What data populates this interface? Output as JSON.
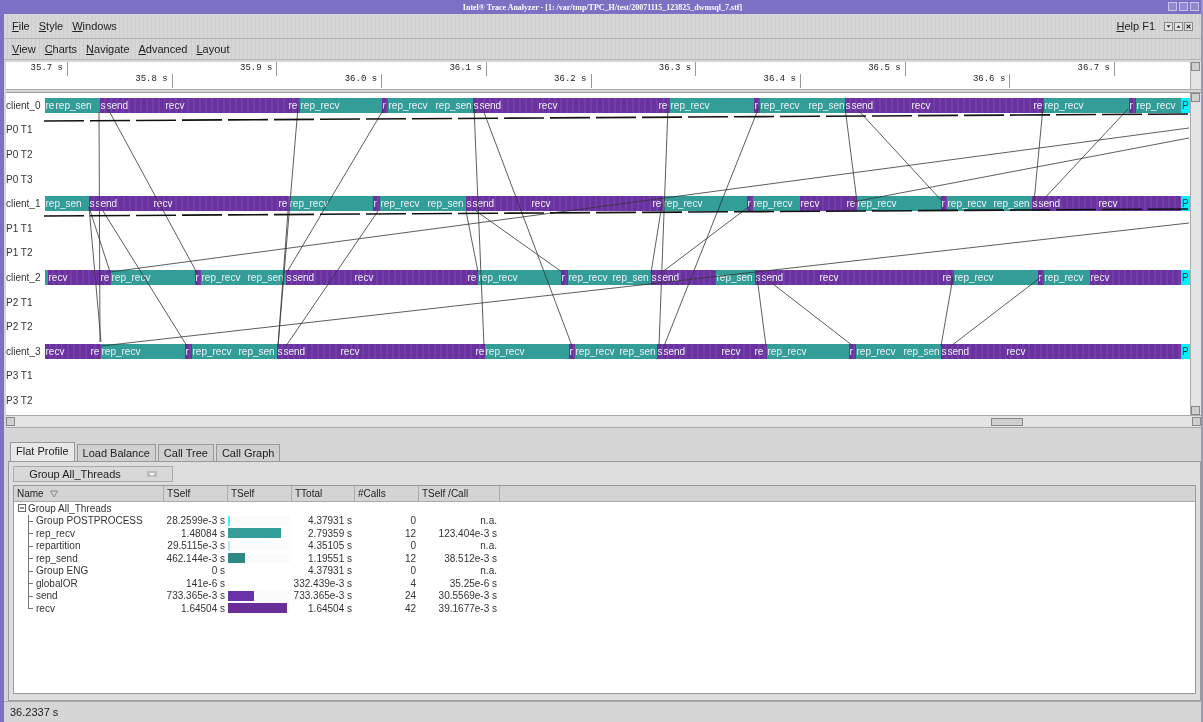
{
  "window": {
    "title": "Intel® Trace Analyzer - [1: /var/tmp/TPC_H/test/20071115_123825_dwmsql_7.stf]"
  },
  "menu": [
    "File",
    "Style",
    "Windows"
  ],
  "help": "Help F1",
  "chart_menu": [
    "View",
    "Charts",
    "Navigate",
    "Advanced",
    "Layout"
  ],
  "ruler": [
    "35.7 s",
    "35.8 s",
    "35.9 s",
    "36.0 s",
    "36.1 s",
    "36.2 s",
    "36.3 s",
    "36.4 s",
    "36.5 s",
    "36.6 s",
    "36.7 s"
  ],
  "lanes": [
    {
      "label": "client_0",
      "segments": [
        {
          "kind": "rep",
          "label": "re"
        },
        {
          "kind": "rep",
          "label": "rep_sen"
        },
        {
          "kind": "mpi",
          "label": "s"
        },
        {
          "kind": "mpi",
          "label": "send"
        },
        {
          "kind": "mpi",
          "label": "recv"
        },
        {
          "kind": "mpi",
          "label": "re"
        },
        {
          "kind": "rep",
          "label": "rep_recv"
        },
        {
          "kind": "mpi",
          "label": "r"
        },
        {
          "kind": "rep",
          "label": "rep_recv"
        },
        {
          "kind": "rep",
          "label": "rep_sen"
        },
        {
          "kind": "mpi",
          "label": "s"
        },
        {
          "kind": "mpi",
          "label": "send"
        },
        {
          "kind": "mpi",
          "label": "recv"
        },
        {
          "kind": "mpi",
          "label": "re"
        },
        {
          "kind": "rep",
          "label": "rep_recv"
        },
        {
          "kind": "mpi",
          "label": "r"
        },
        {
          "kind": "rep",
          "label": "rep_recv"
        },
        {
          "kind": "rep",
          "label": "rep_sen"
        },
        {
          "kind": "mpi",
          "label": "s"
        },
        {
          "kind": "mpi",
          "label": "send"
        },
        {
          "kind": "mpi",
          "label": "recv"
        },
        {
          "kind": "mpi",
          "label": "re"
        },
        {
          "kind": "rep",
          "label": "rep_recv"
        },
        {
          "kind": "mpi",
          "label": "r"
        },
        {
          "kind": "rep",
          "label": "rep_recv"
        },
        {
          "kind": "post",
          "label": "P"
        }
      ]
    },
    {
      "label": "P0 T1"
    },
    {
      "label": "P0 T2"
    },
    {
      "label": "P0 T3"
    },
    {
      "label": "client_1",
      "segments": [
        {
          "kind": "rep",
          "label": "rep_sen"
        },
        {
          "kind": "mpi",
          "label": "s"
        },
        {
          "kind": "mpi",
          "label": "send"
        },
        {
          "kind": "mpi",
          "label": "recv"
        },
        {
          "kind": "mpi",
          "label": "re"
        },
        {
          "kind": "rep",
          "label": "rep_recv"
        },
        {
          "kind": "mpi",
          "label": "r"
        },
        {
          "kind": "rep",
          "label": "rep_recv"
        },
        {
          "kind": "rep",
          "label": "rep_sen"
        },
        {
          "kind": "mpi",
          "label": "s"
        },
        {
          "kind": "mpi",
          "label": "send"
        },
        {
          "kind": "mpi",
          "label": "recv"
        },
        {
          "kind": "mpi",
          "label": "re"
        },
        {
          "kind": "rep",
          "label": "rep_recv"
        },
        {
          "kind": "mpi",
          "label": "r"
        },
        {
          "kind": "rep",
          "label": "rep_recv"
        },
        {
          "kind": "mpi",
          "label": "recv"
        },
        {
          "kind": "mpi",
          "label": "re"
        },
        {
          "kind": "rep",
          "label": "rep_recv"
        },
        {
          "kind": "mpi",
          "label": "r"
        },
        {
          "kind": "rep",
          "label": "rep_recv"
        },
        {
          "kind": "rep",
          "label": "rep_sen"
        },
        {
          "kind": "mpi",
          "label": "s"
        },
        {
          "kind": "mpi",
          "label": "send"
        },
        {
          "kind": "mpi",
          "label": "recv"
        },
        {
          "kind": "post",
          "label": "P"
        }
      ]
    },
    {
      "label": "P1 T1"
    },
    {
      "label": "P1 T2"
    },
    {
      "label": "client_2",
      "segments": [
        {
          "kind": "rep"
        },
        {
          "kind": "mpi",
          "label": "recv"
        },
        {
          "kind": "mpi",
          "label": "re"
        },
        {
          "kind": "rep",
          "label": "rep_recv"
        },
        {
          "kind": "mpi",
          "label": "r"
        },
        {
          "kind": "rep",
          "label": "rep_recv"
        },
        {
          "kind": "rep",
          "label": "rep_sen"
        },
        {
          "kind": "mpi",
          "label": "s"
        },
        {
          "kind": "mpi",
          "label": "send"
        },
        {
          "kind": "mpi",
          "label": "recv"
        },
        {
          "kind": "mpi",
          "label": "re"
        },
        {
          "kind": "rep",
          "label": "rep_recv"
        },
        {
          "kind": "mpi",
          "label": "r"
        },
        {
          "kind": "rep",
          "label": "rep_recv"
        },
        {
          "kind": "rep",
          "label": "rep_sen"
        },
        {
          "kind": "mpi",
          "label": "s"
        },
        {
          "kind": "mpi",
          "label": "send"
        },
        {
          "kind": "rep",
          "label": "rep_sen"
        },
        {
          "kind": "mpi",
          "label": "s"
        },
        {
          "kind": "mpi",
          "label": "send"
        },
        {
          "kind": "mpi",
          "label": "recv"
        },
        {
          "kind": "mpi",
          "label": "re"
        },
        {
          "kind": "rep",
          "label": "rep_recv"
        },
        {
          "kind": "mpi",
          "label": "r"
        },
        {
          "kind": "rep",
          "label": "rep_recv"
        },
        {
          "kind": "mpi",
          "label": "recv"
        },
        {
          "kind": "post",
          "label": "P"
        }
      ]
    },
    {
      "label": "P2 T1"
    },
    {
      "label": "P2 T2"
    },
    {
      "label": "client_3",
      "segments": [
        {
          "kind": "mpi",
          "label": "recv"
        },
        {
          "kind": "mpi",
          "label": "re"
        },
        {
          "kind": "rep",
          "label": "rep_recv"
        },
        {
          "kind": "mpi",
          "label": "r"
        },
        {
          "kind": "rep",
          "label": "rep_recv"
        },
        {
          "kind": "rep",
          "label": "rep_sen"
        },
        {
          "kind": "mpi",
          "label": "s"
        },
        {
          "kind": "mpi",
          "label": "send"
        },
        {
          "kind": "mpi",
          "label": "recv"
        },
        {
          "kind": "mpi",
          "label": "re"
        },
        {
          "kind": "rep",
          "label": "rep_recv"
        },
        {
          "kind": "mpi",
          "label": "r"
        },
        {
          "kind": "rep",
          "label": "rep_recv"
        },
        {
          "kind": "rep",
          "label": "rep_sen"
        },
        {
          "kind": "mpi",
          "label": "s"
        },
        {
          "kind": "mpi",
          "label": "send"
        },
        {
          "kind": "mpi",
          "label": "recv"
        },
        {
          "kind": "mpi",
          "label": "re"
        },
        {
          "kind": "rep",
          "label": "rep_recv"
        },
        {
          "kind": "mpi",
          "label": "r"
        },
        {
          "kind": "rep",
          "label": "rep_recv"
        },
        {
          "kind": "rep",
          "label": "rep_sen"
        },
        {
          "kind": "mpi",
          "label": "s"
        },
        {
          "kind": "mpi",
          "label": "send"
        },
        {
          "kind": "mpi",
          "label": "recv"
        },
        {
          "kind": "post",
          "label": "P"
        }
      ]
    },
    {
      "label": "P3 T1"
    },
    {
      "label": "P3 T2"
    }
  ],
  "tabs": [
    {
      "label": "Flat Profile",
      "selected": true
    },
    {
      "label": "Load Balance",
      "selected": false
    },
    {
      "label": "Call Tree",
      "selected": false
    },
    {
      "label": "Call Graph",
      "selected": false
    }
  ],
  "group_select": {
    "value": "Group All_Threads"
  },
  "table": {
    "columns": [
      "Name",
      "TSelf",
      "TSelf",
      "TTotal",
      "#Calls",
      "TSelf /Call"
    ],
    "rows": [
      {
        "name": "Group All_Threads",
        "expanded": true,
        "children": [
          {
            "name": "Group POSTPROCESS",
            "tself": "28.2599e-3 s",
            "level": 0.03,
            "color": "#40f0ff",
            "ttotal": "4.37931 s",
            "calls": "0",
            "tself_call": "n.a."
          },
          {
            "name": "rep_recv",
            "tself": "1.48084 s",
            "level": 0.85,
            "color": "#339e98",
            "ttotal": "2.79359 s",
            "calls": "12",
            "tself_call": "123.404e-3 s"
          },
          {
            "name": "repartition",
            "tself": "29.5115e-3 s",
            "level": 0.03,
            "color": "#b8e8ec",
            "ttotal": "4.35105 s",
            "calls": "0",
            "tself_call": "n.a."
          },
          {
            "name": "rep_send",
            "tself": "462.144e-3 s",
            "level": 0.27,
            "color": "#2e8a86",
            "ttotal": "1.19551 s",
            "calls": "12",
            "tself_call": "38.512e-3 s"
          },
          {
            "name": "Group ENG",
            "tself": "0 s",
            "ttotal": "4.37931 s",
            "calls": "0",
            "tself_call": "n.a."
          },
          {
            "name": "globalOR",
            "tself": "141e-6 s",
            "ttotal": "332.439e-3 s",
            "calls": "4",
            "tself_call": "35.25e-6 s"
          },
          {
            "name": "send",
            "tself": "733.365e-3 s",
            "level": 0.42,
            "color": "#6a32a8",
            "ttotal": "733.365e-3 s",
            "calls": "24",
            "tself_call": "30.5569e-3 s"
          },
          {
            "name": "recv",
            "tself": "1.64504 s",
            "level": 0.95,
            "color": "#6a2e98",
            "ttotal": "1.64504 s",
            "calls": "42",
            "tself_call": "39.1677e-3 s"
          }
        ]
      }
    ]
  },
  "status_bar": "36.2337 s"
}
